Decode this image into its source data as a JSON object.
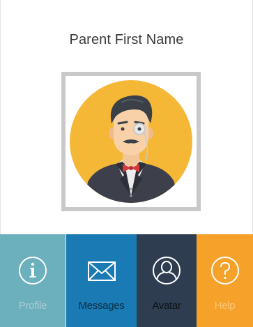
{
  "profile": {
    "name": "Parent First Name"
  },
  "nav": {
    "items": [
      {
        "label": "Profile",
        "icon": "info-icon",
        "bg": "#6db0bd",
        "label_color": "#a8cdd5"
      },
      {
        "label": "Messages",
        "icon": "envelope-icon",
        "bg": "#1a7ab3",
        "label_color": "#0c2f47"
      },
      {
        "label": "Avatar",
        "icon": "user-icon",
        "bg": "#2e3e50",
        "label_color": "#0b1118"
      },
      {
        "label": "Help",
        "icon": "question-icon",
        "bg": "#f5a12a",
        "label_color": "#fbc777"
      }
    ]
  },
  "colors": {
    "avatar_background": "#f5b736",
    "frame": "#c9c9c9",
    "title_text": "#3a3a3a"
  }
}
